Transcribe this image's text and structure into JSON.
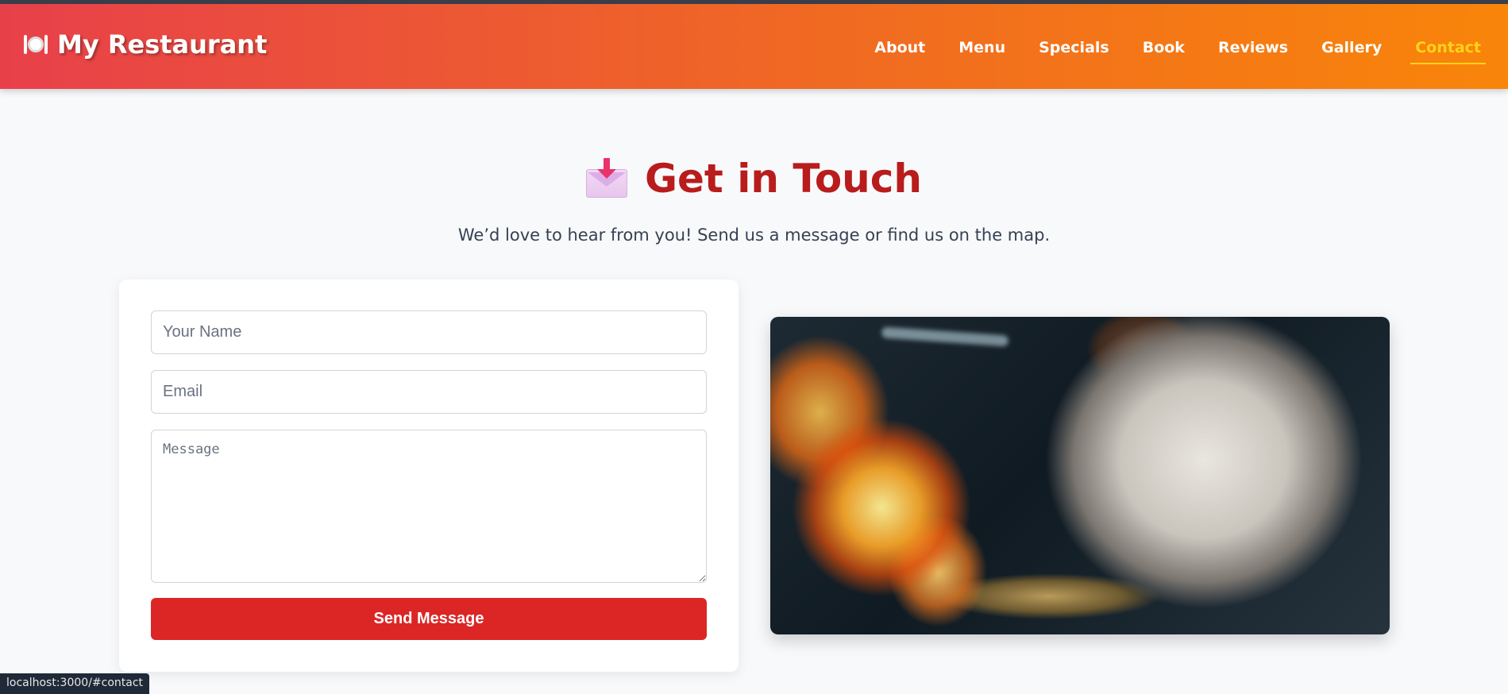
{
  "header": {
    "brand": "My Restaurant",
    "brand_icon": "fork-knife-plate-icon",
    "nav": [
      {
        "label": "About",
        "active": false
      },
      {
        "label": "Menu",
        "active": false
      },
      {
        "label": "Specials",
        "active": false
      },
      {
        "label": "Book",
        "active": false
      },
      {
        "label": "Reviews",
        "active": false
      },
      {
        "label": "Gallery",
        "active": false
      },
      {
        "label": "Contact",
        "active": true
      }
    ]
  },
  "contact": {
    "title": "Get in Touch",
    "title_icon": "incoming-envelope-icon",
    "subtitle": "We’d love to hear from you! Send us a message or find us on the map.",
    "form": {
      "name_placeholder": "Your Name",
      "name_value": "",
      "email_placeholder": "Email",
      "email_value": "",
      "message_placeholder": "Message",
      "message_value": "",
      "submit_label": "Send Message"
    },
    "image_subject": "chef cooking over flames"
  },
  "status_bar": {
    "url": "localhost:3000/#contact"
  },
  "colors": {
    "accent_red": "#dc2626",
    "title_red": "#b91c1c",
    "header_gradient_start": "#e8404a",
    "header_gradient_end": "#f9850a",
    "active_nav": "#ffd21a"
  }
}
